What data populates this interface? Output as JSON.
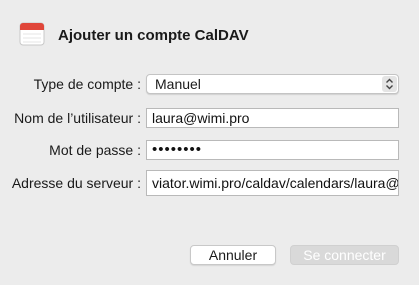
{
  "dialog": {
    "title": "Ajouter un compte CalDAV",
    "icon": "calendar-icon"
  },
  "form": {
    "account_type": {
      "label": "Type de compte :",
      "value": "Manuel"
    },
    "username": {
      "label": "Nom de l’utilisateur :",
      "value": "laura@wimi.pro"
    },
    "password": {
      "label": "Mot de passe :",
      "value": "••••••••"
    },
    "server": {
      "label": "Adresse du serveur :",
      "value": "viator.wimi.pro/caldav/calendars/laura@w"
    }
  },
  "buttons": {
    "cancel": "Annuler",
    "connect": "Se connecter"
  }
}
